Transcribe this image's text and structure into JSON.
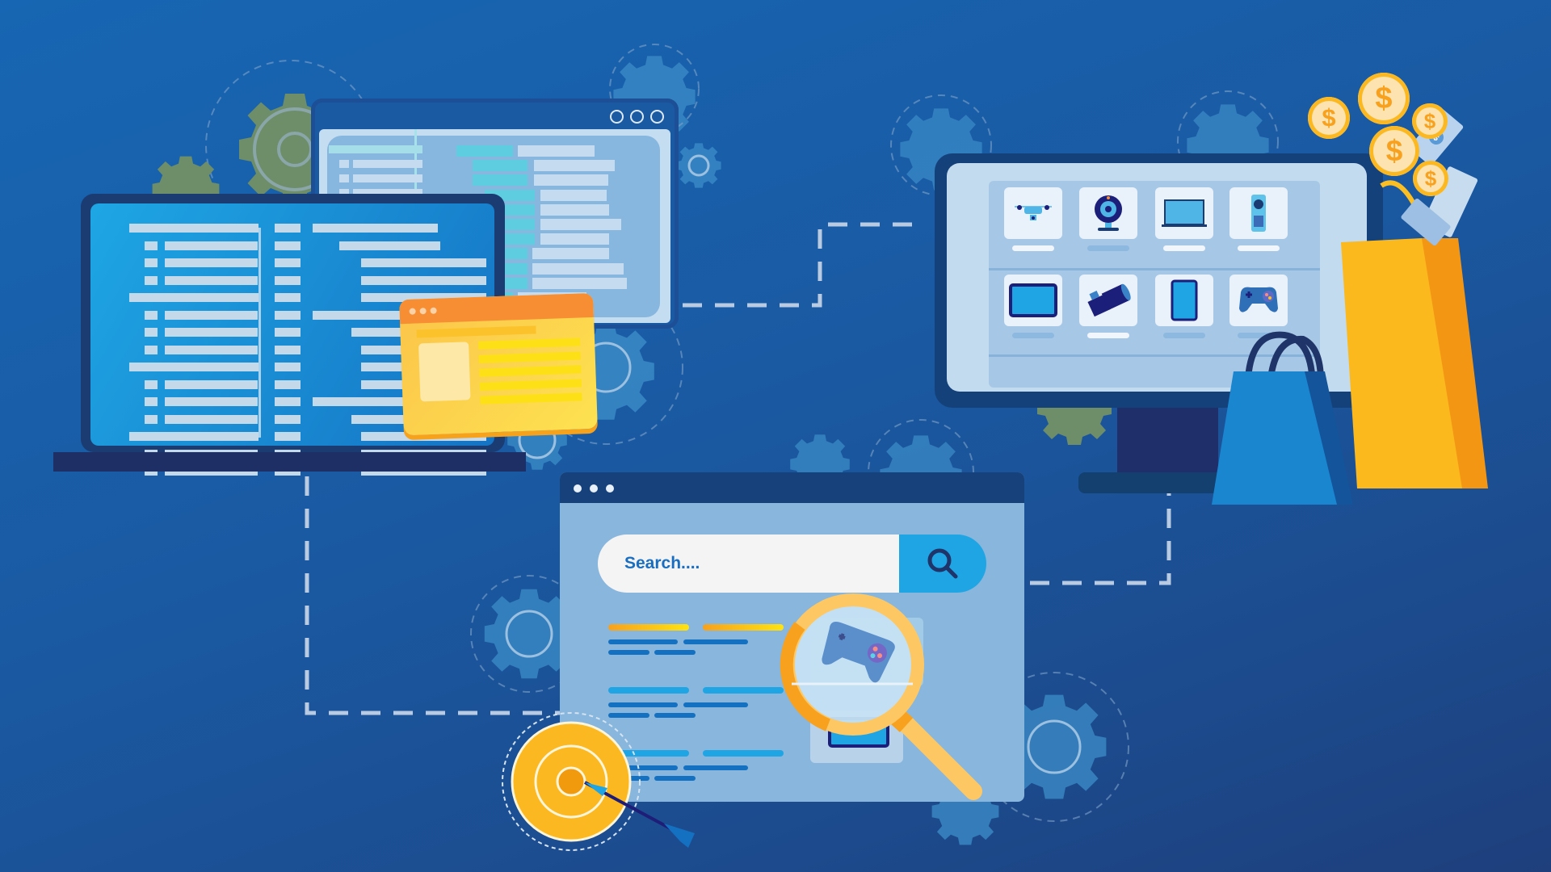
{
  "scene": {
    "description": "E-commerce search and product discovery illustration",
    "colors": {
      "background": "#1a5aa3",
      "accent_yellow": "#fbbf24",
      "accent_orange": "#f7941d",
      "search_button": "#1fa5e4",
      "window_header": "#16417a"
    }
  },
  "search_window": {
    "window_controls": [
      "dot",
      "dot",
      "dot"
    ],
    "search_input": {
      "placeholder": "Search...."
    },
    "search_button_icon": "search-icon",
    "results": [
      {
        "title_color": "orange",
        "lines": 2
      },
      {
        "title_color": "blue",
        "lines": 2
      },
      {
        "title_color": "blue",
        "lines": 2
      }
    ]
  },
  "store_monitor": {
    "products": [
      {
        "icon": "drone-icon"
      },
      {
        "icon": "webcam-icon"
      },
      {
        "icon": "laptop-icon"
      },
      {
        "icon": "remote-icon"
      },
      {
        "icon": "monitor-icon"
      },
      {
        "icon": "camera-icon"
      },
      {
        "icon": "tablet-icon"
      },
      {
        "icon": "gamepad-icon"
      }
    ]
  },
  "coins": {
    "symbol": "$",
    "count": 5
  },
  "cash_symbol": "$"
}
